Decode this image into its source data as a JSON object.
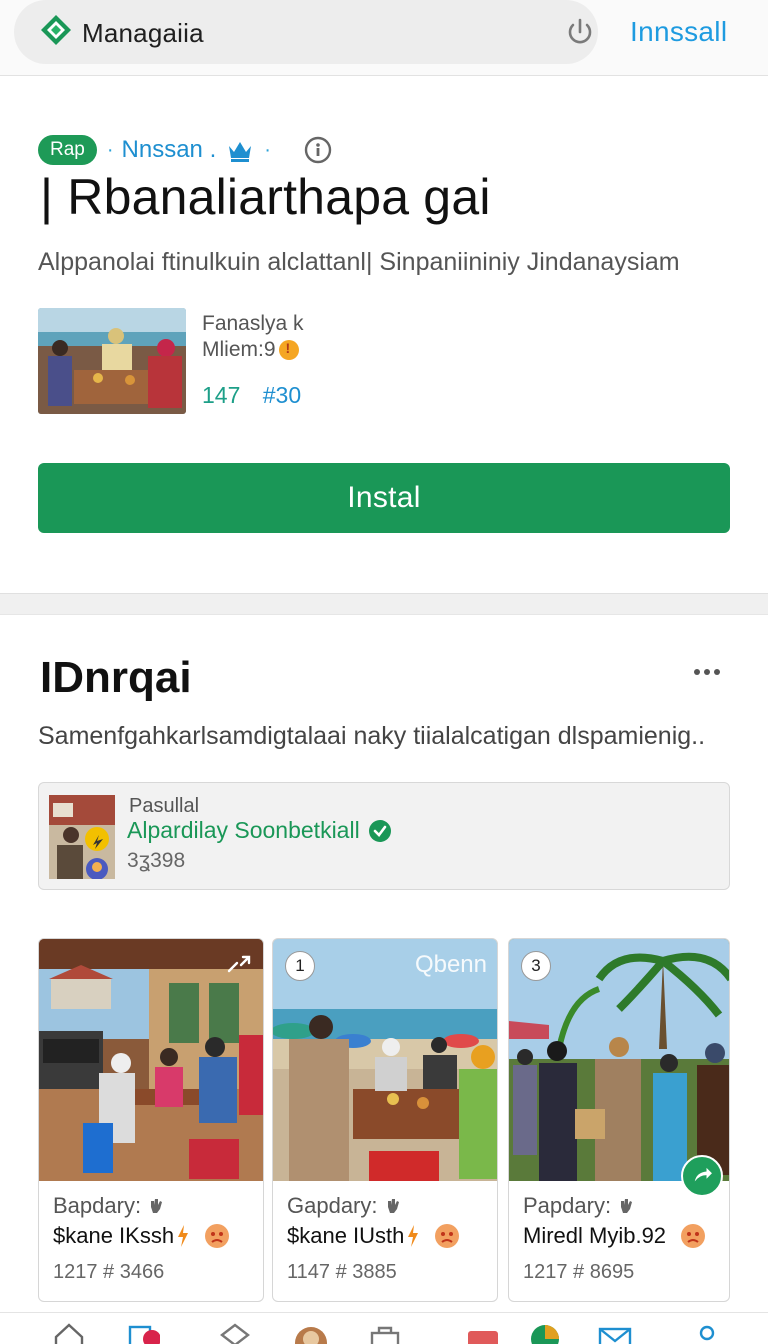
{
  "topbar": {
    "app_name": "Managaiia",
    "install_label": "Innssall"
  },
  "hero": {
    "tag": "Rap",
    "developer": "Nnssan .",
    "title": "| Rbanaliarthapa gai",
    "subtitle": "Alppanolai ftinulkuin alclattanl| Sinpaniininiy Jindanaysiam",
    "meta_line1": "Fanaslya k",
    "meta_line2": "Mliem:9",
    "stat1": "147",
    "stat2": "#30",
    "install_button": "Instal"
  },
  "section": {
    "title": "IDnrqai",
    "subtitle": "Samenfgahkarlsamdigtalaai naky tiialalcatigan dlspamienig..",
    "promo": {
      "label": "Pasullal",
      "name": "Alpardilay Soonbetkiall",
      "count": "3ʓ398"
    }
  },
  "cards": [
    {
      "label": "Bapdary:",
      "name": "$kane IKssh",
      "stats": "1217 # 3466",
      "badge": "",
      "watermark": ""
    },
    {
      "label": "Gapdary:",
      "name": "$kane IUsth",
      "stats": "1147 # 3885",
      "badge": "1",
      "watermark": "Qbenn"
    },
    {
      "label": "Papdary:",
      "name": "Miredl Myib.92",
      "stats": "1217 # 8695",
      "badge": "3",
      "watermark": ""
    }
  ],
  "colors": {
    "accent_green": "#1a9757",
    "link_blue": "#1e8fd0",
    "teal_stats": "#1d9f88"
  },
  "icons": [
    "diamond-logo-icon",
    "power-icon",
    "crown-icon",
    "info-icon",
    "more-icon",
    "verified-icon",
    "hand-icon",
    "bolt-icon",
    "sad-face-icon",
    "share-icon",
    "home-icon",
    "apps-icon",
    "games-icon",
    "profile-icon",
    "store-icon",
    "gift-icon",
    "chart-icon",
    "mail-icon",
    "account-icon"
  ]
}
